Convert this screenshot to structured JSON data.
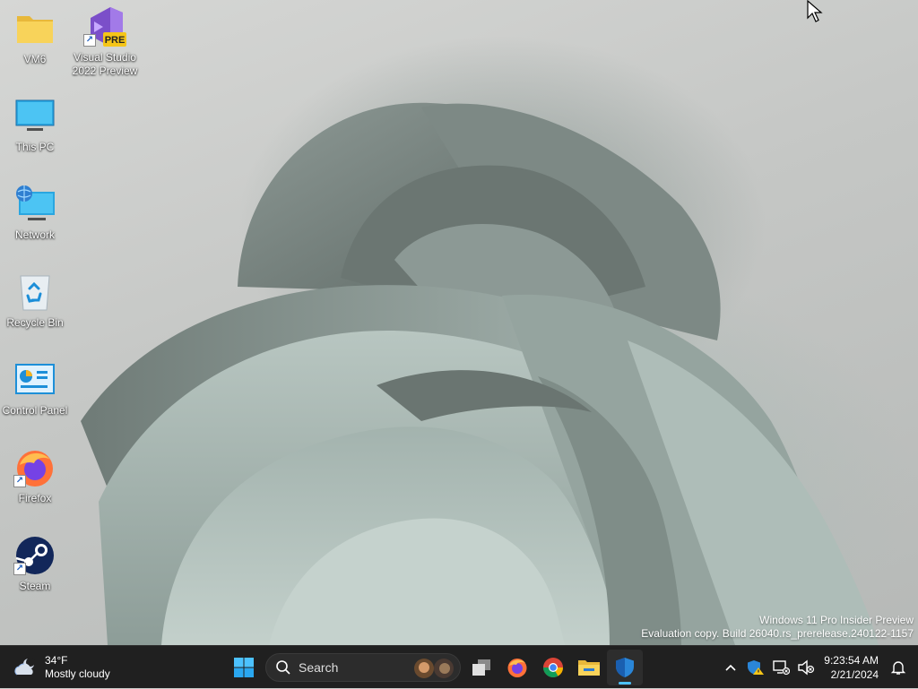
{
  "desktop": {
    "icons": [
      {
        "label": "VM6",
        "icon": "folder-icon",
        "shortcut": false
      },
      {
        "label": "Visual Studio 2022 Preview",
        "icon": "visual-studio-preview-icon",
        "badge": "PRE",
        "shortcut": true
      },
      {
        "label": "This PC",
        "icon": "monitor-icon",
        "shortcut": false
      },
      {
        "label": "Network",
        "icon": "network-icon",
        "shortcut": false
      },
      {
        "label": "Recycle Bin",
        "icon": "recycle-bin-icon",
        "shortcut": false
      },
      {
        "label": "Control Panel",
        "icon": "control-panel-icon",
        "shortcut": false
      },
      {
        "label": "Firefox",
        "icon": "firefox-icon",
        "shortcut": true
      },
      {
        "label": "Steam",
        "icon": "steam-icon",
        "shortcut": true
      }
    ],
    "watermark": {
      "line1": "Windows 11 Pro Insider Preview",
      "line2": "Evaluation copy. Build 26040.rs_prerelease.240122-1157"
    }
  },
  "taskbar": {
    "weather": {
      "temperature": "34°F",
      "condition": "Mostly cloudy",
      "icon": "cloudy-moon-icon"
    },
    "start_icon": "windows-start-icon",
    "search": {
      "placeholder": "Search",
      "icon": "search-icon"
    },
    "pinned": [
      {
        "name": "task-view",
        "icon": "task-view-icon"
      },
      {
        "name": "firefox",
        "icon": "firefox-icon"
      },
      {
        "name": "chrome",
        "icon": "chrome-icon"
      },
      {
        "name": "file-explorer",
        "icon": "file-explorer-icon"
      },
      {
        "name": "windows-security",
        "icon": "shield-icon",
        "active": true
      }
    ],
    "tray": {
      "icons": [
        "chevron-up-icon",
        "security-warning-icon",
        "network-disconnected-icon",
        "volume-muted-icon"
      ],
      "time": "9:23:54 AM",
      "date": "2/21/2024",
      "notification_icon": "bell-icon"
    }
  },
  "colors": {
    "taskbar_bg": "#202020",
    "accent": "#4cc2ff",
    "windows_blue": "#0078d4"
  }
}
